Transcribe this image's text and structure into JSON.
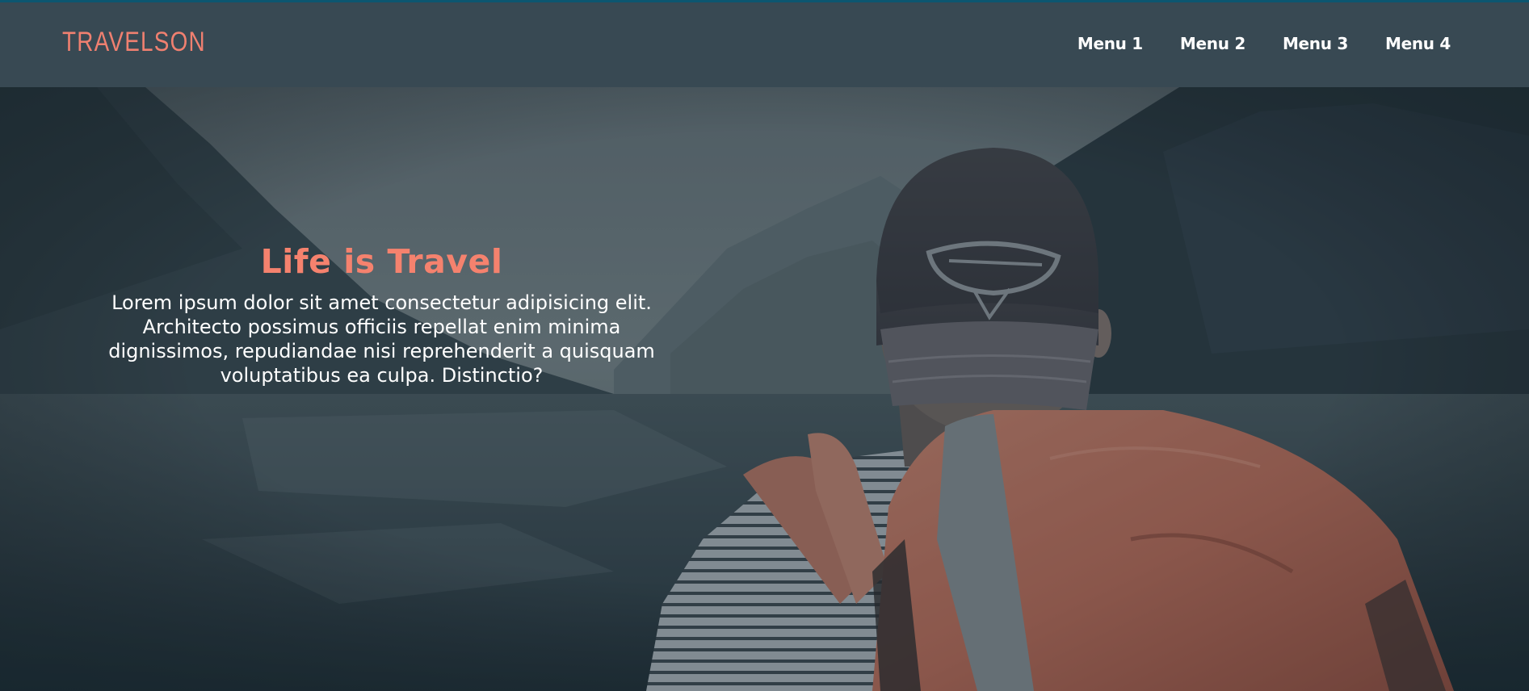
{
  "header": {
    "logo": "TRAVELSON",
    "nav": [
      "Menu 1",
      "Menu 2",
      "Menu 3",
      "Menu 4"
    ]
  },
  "hero": {
    "title": "Life is Travel",
    "body": "Lorem ipsum dolor sit amet consectetur adipisicing elit. Architecto possimus officiis repellat enim minima dignissimos, repudiandae nisi reprehenderit a quisquam voluptatibus ea culpa. Distinctio?",
    "image": "traveler-with-cap-and-orange-backpack-facing-mountain-lake"
  },
  "colors": {
    "accent": "#f5826e",
    "header_bg": "#384953",
    "top_line": "#0c5670",
    "hero_dark": "#1f2f38"
  }
}
